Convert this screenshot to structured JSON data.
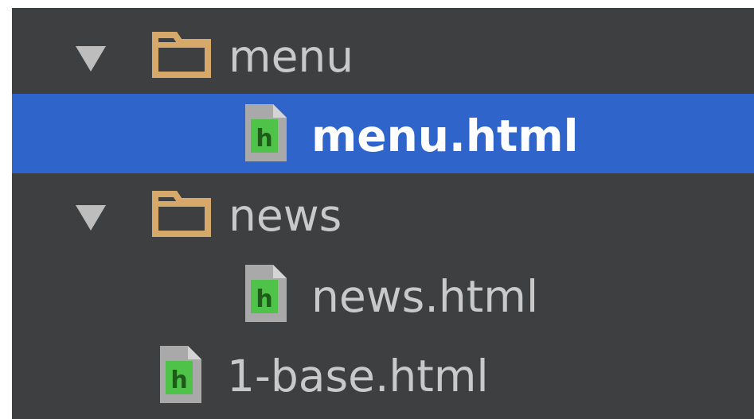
{
  "project_tree": {
    "items": [
      {
        "type": "folder",
        "label": "menu",
        "expanded": true,
        "selected": false,
        "icon": "folder-icon"
      },
      {
        "type": "file",
        "label": "menu.html",
        "selected": true,
        "icon": "html-file-icon"
      },
      {
        "type": "folder",
        "label": "news",
        "expanded": true,
        "selected": false,
        "icon": "folder-icon"
      },
      {
        "type": "file",
        "label": "news.html",
        "selected": false,
        "icon": "html-file-icon"
      },
      {
        "type": "file",
        "label": "1-base.html",
        "selected": false,
        "icon": "html-file-icon"
      }
    ]
  },
  "colors": {
    "background": "#3d3f41",
    "selection": "#2f65ca",
    "folder": "#d6a86a",
    "file_badge": "#4fc24a",
    "text": "#c9c9c9",
    "selected_text": "#ffffff"
  }
}
